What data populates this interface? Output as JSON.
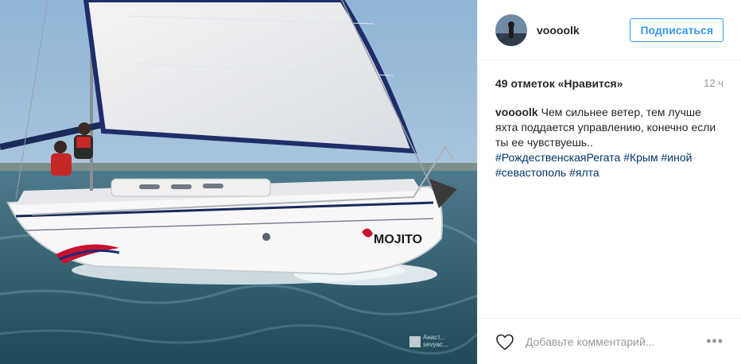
{
  "profile": {
    "username": "voooolk",
    "follow_label": "Подписаться"
  },
  "post": {
    "likes_text": "49 отметок «Нравится»",
    "time_ago": "12 ч",
    "caption_user": "voooolk",
    "caption_text": "Чем сильнее ветер, тем лучше яхта поддается управлению, конечно если ты ее чувствуешь..",
    "hashtags": [
      "#РождественскаяРегата",
      "#Крым",
      "#иной",
      "#севастополь",
      "#ялта"
    ],
    "image": {
      "hull_name": "MOJITO",
      "watermark_line1": "Анаст...",
      "watermark_line2": "sevyac..."
    }
  },
  "comment_box": {
    "placeholder": "Добавьте комментарий..."
  },
  "colors": {
    "accent": "#3897f0",
    "hashtag": "#003569",
    "muted": "#999999"
  },
  "icons": {
    "like": "heart-outline-icon",
    "more": "more-options-icon"
  }
}
